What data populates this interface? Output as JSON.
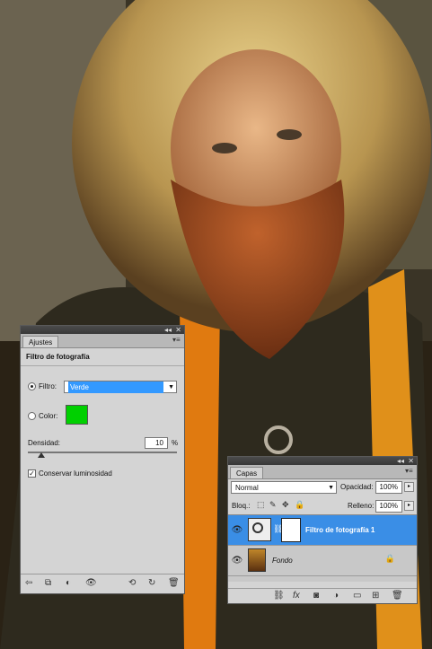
{
  "adjustments_panel": {
    "tab_label": "Ajustes",
    "title": "Filtro de fotografía",
    "filter_label": "Filtro:",
    "filter_value": "Verde",
    "color_label": "Color:",
    "color_swatch": "#00d000",
    "density_label": "Densidad:",
    "density_value": "10",
    "density_unit": "%",
    "density_level_percent": 10,
    "preserve_label": "Conservar luminosidad",
    "preserve_checked": "✓",
    "filter_selected": true,
    "color_selected": false
  },
  "layers_panel": {
    "tab_label": "Capas",
    "blend_mode": "Normal",
    "opacity_label": "Opacidad:",
    "opacity_value": "100%",
    "lock_label": "Bloq.:",
    "fill_label": "Relleno:",
    "fill_value": "100%",
    "layers": [
      {
        "name": "Filtro de fotografía 1",
        "selected": true
      },
      {
        "name": "Fondo",
        "selected": false
      }
    ],
    "accent": "#3a8ee6"
  },
  "panel_controls": {
    "collapse": "◂◂",
    "close": "✕"
  }
}
